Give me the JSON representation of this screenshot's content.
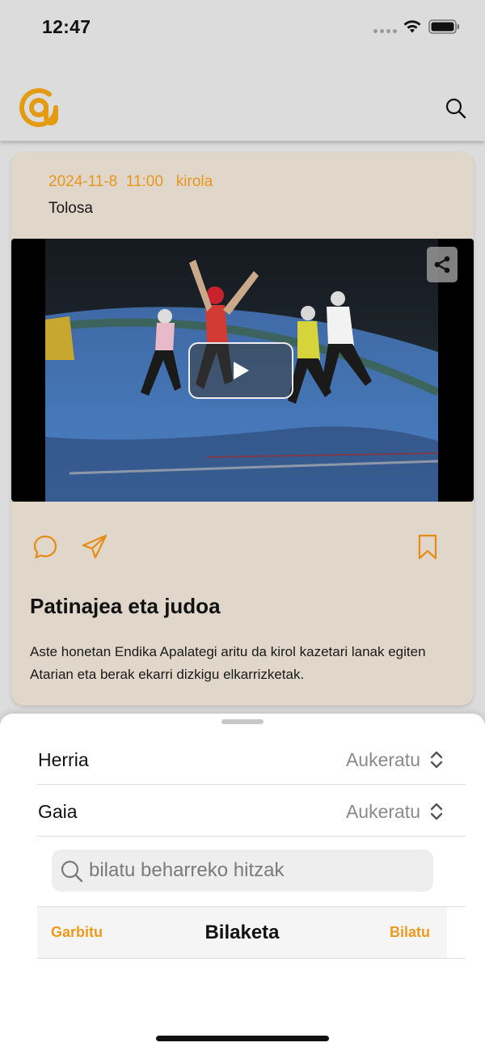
{
  "status_bar": {
    "time": "12:47"
  },
  "header": {
    "logo_icon": "at-sign-logo-icon",
    "search_icon": "search-icon"
  },
  "article": {
    "date": "2024-11-8",
    "time": "11:00",
    "category": "kirola",
    "place": "Tolosa",
    "title": "Patinajea eta judoa",
    "description": "Aste honetan Endika Apalategi aritu da kirol kazetari lanak egiten Atarian eta berak ekarri dizkigu elkarrizketak.",
    "actions": [
      "comment-icon",
      "send-icon",
      "bookmark-icon"
    ]
  },
  "filter_sheet": {
    "rows": [
      {
        "label": "Herria",
        "value": "Aukeratu"
      },
      {
        "label": "Gaia",
        "value": "Aukeratu"
      }
    ],
    "search_placeholder": "bilatu beharreko hitzak",
    "toolbar": {
      "clear_label": "Garbitu",
      "title": "Bilaketa",
      "search_label": "Bilatu"
    }
  },
  "colors": {
    "accent": "#ee9a1f",
    "card_bg": "#e0d6c9",
    "background": "#dcdcdc"
  }
}
